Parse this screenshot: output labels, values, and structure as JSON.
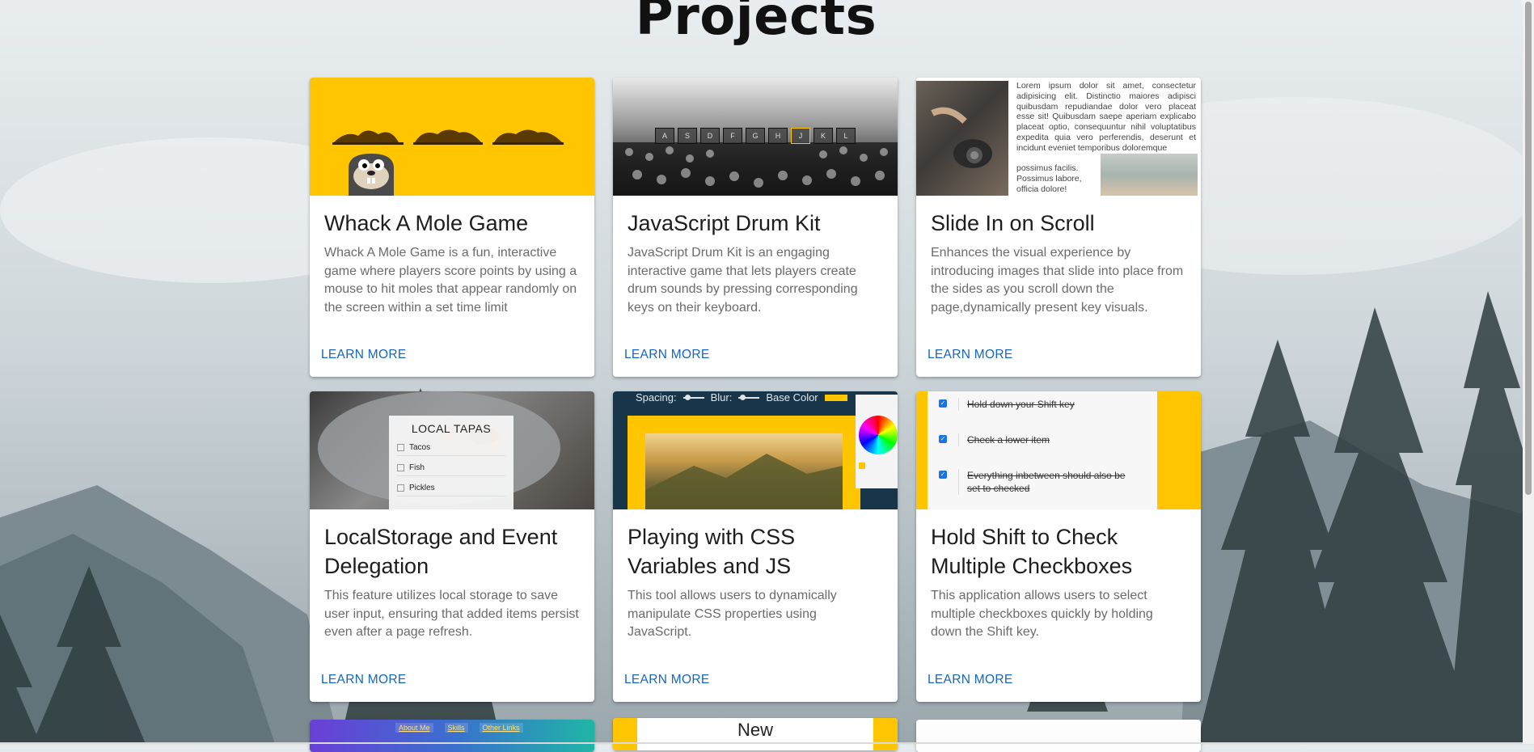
{
  "page": {
    "title": "Projects"
  },
  "cards": [
    {
      "title": "Whack A Mole Game",
      "description": "Whack A Mole Game is a fun, interactive game where players score points by using a mouse to hit moles that appear randomly on the screen within a set time limit",
      "action": "LEARN MORE"
    },
    {
      "title": "JavaScript Drum Kit",
      "description": "JavaScript Drum Kit is an engaging interactive game that lets players create drum sounds by pressing corresponding keys on their keyboard.",
      "action": "LEARN MORE",
      "keys": [
        "A",
        "S",
        "D",
        "F",
        "G",
        "H",
        "J",
        "K",
        "L"
      ]
    },
    {
      "title": "Slide In on Scroll",
      "description": "Enhances the visual experience by introducing images that slide into place from the sides as you scroll down the page,dynamically present key visuals.",
      "action": "LEARN MORE",
      "thumb_text": "Lorem ipsum dolor sit amet, consectetur adipisicing elit. Distinctio maiores adipisci quibusdam repudiandae dolor vero placeat esse sit! Quibusdam saepe aperiam explicabo placeat optio, consequuntur nihil voluptatibus expedita quia vero perferendis, deserunt et incidunt eveniet temporibus doloremque",
      "thumb_text2": [
        "possimus facilis.",
        "Possimus labore,",
        "officia dolore!"
      ]
    },
    {
      "title": "LocalStorage and Event Delegation",
      "description": "This feature utilizes local storage to save user input, ensuring that added items persist even after a page refresh.",
      "action": "LEARN MORE",
      "thumb_heading": "LOCAL TAPAS",
      "thumb_items": [
        "Tacos",
        "Fish",
        "Pickles"
      ]
    },
    {
      "title": "Playing with CSS Variables and JS",
      "description": "This tool allows users to dynamically manipulate CSS properties using JavaScript.",
      "action": "LEARN MORE",
      "thumb_controls": [
        "Spacing:",
        "Blur:",
        "Base Color"
      ]
    },
    {
      "title": "Hold Shift to Check Multiple Checkboxes",
      "description": "This application allows users to select multiple checkboxes quickly by holding down the Shift key.",
      "action": "LEARN MORE",
      "thumb_items": [
        "Hold down your Shift key",
        "Check a lower item",
        "Everything inbetween should also be",
        "set to checked"
      ]
    }
  ],
  "partial_cards": {
    "left_links": [
      "About Me",
      "Skills",
      "Other Links"
    ],
    "middle_text": "New"
  },
  "colors": {
    "accent": "#1565c0",
    "mole_yellow": "#ffc600"
  }
}
